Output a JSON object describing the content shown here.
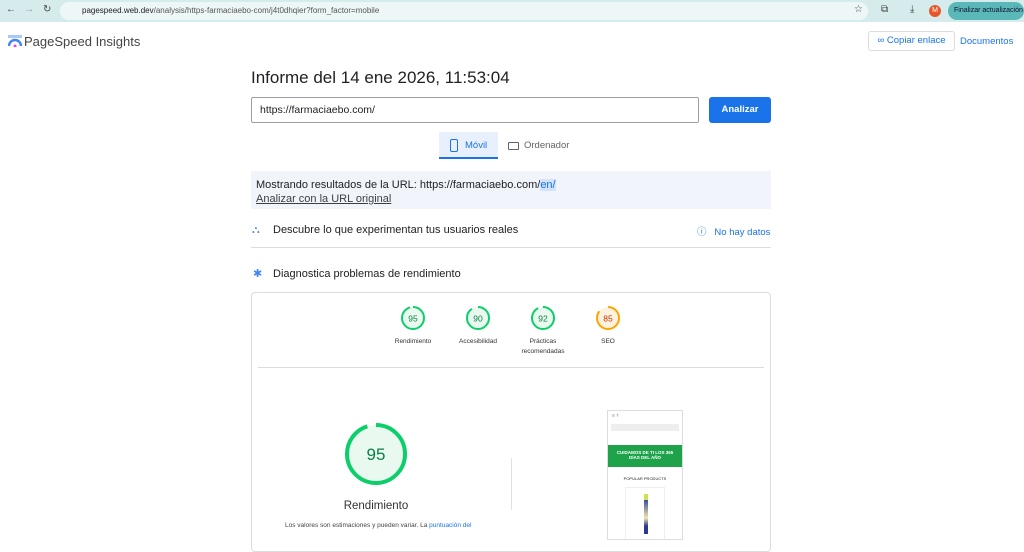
{
  "browser": {
    "url_host": "pagespeed.web.dev",
    "url_path": "/analysis/https-farmaciaebo-com/j4t0dhqier?form_factor=mobile",
    "update_label": "Finalizar actualización",
    "avatar": "M"
  },
  "header": {
    "brand": "PageSpeed Insights",
    "copy_link": "Copiar enlace",
    "docs": "Documentos"
  },
  "report": {
    "title": "Informe del 14 ene 2026, 11:53:04",
    "url_value": "https://farmaciaebo.com/",
    "analyze": "Analizar"
  },
  "tabs": [
    {
      "label": "Móvil"
    },
    {
      "label": "Ordenador"
    }
  ],
  "notice": {
    "prefix": "Mostrando resultados de la URL: https://farmaciaebo.com/",
    "suffix": "en/",
    "link": "Analizar con la URL original"
  },
  "crux": {
    "title": "Descubre lo que experimentan tus usuarios reales",
    "status": "No hay datos"
  },
  "diag": {
    "title": "Diagnostica problemas de rendimiento"
  },
  "scores": [
    {
      "value": 95,
      "label": "Rendimiento",
      "color": "#0cce6b"
    },
    {
      "value": 90,
      "label": "Accesibilidad",
      "color": "#0cce6b"
    },
    {
      "value": 92,
      "label": "Prácticas recomendadas",
      "color": "#0cce6b"
    },
    {
      "value": 85,
      "label": "SEO",
      "color": "#ffa400"
    }
  ],
  "main_score": {
    "value": 95,
    "label": "Rendimiento",
    "note": "Los valores son estimaciones y pueden variar. La ",
    "note_link": "puntuación del"
  },
  "thumbnail": {
    "banner": "CUIDAMOS DE TI LOS 365 DÍAS DEL AÑO",
    "section": "POPULAR PRODUCTS"
  }
}
